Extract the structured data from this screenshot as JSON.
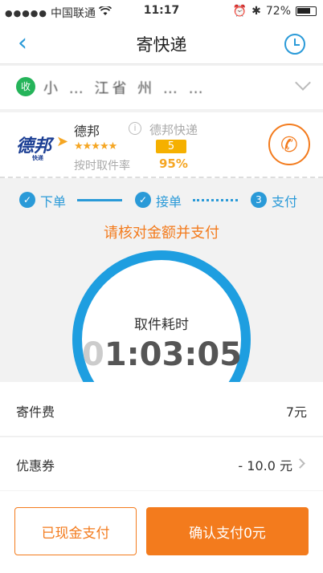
{
  "status_bar": {
    "carrier": "中国联通",
    "time": "11:17",
    "battery": "72%"
  },
  "nav": {
    "title": "寄快递"
  },
  "address": {
    "badge": "收",
    "text": "小 … 江省 州 …  …"
  },
  "courier": {
    "name": "德邦",
    "service": "德邦快递",
    "logo_text": "德邦",
    "logo_sub": "快递",
    "stars": "★★★★★",
    "rating": "5",
    "ontime_label": "按时取件率",
    "ontime_rate": "95%"
  },
  "steps": [
    {
      "label": "下单",
      "mark": "✓"
    },
    {
      "label": "接单",
      "mark": "✓"
    },
    {
      "label": "支付",
      "mark": "3"
    }
  ],
  "pay_prompt": "请核对金额并支付",
  "timer": {
    "label": "取件耗时",
    "lead_digit": "0",
    "value": "1:03:05"
  },
  "fee": {
    "label": "寄件费",
    "value": "7元"
  },
  "coupon": {
    "label": "优惠券",
    "value": "- 10.0 元"
  },
  "actions": {
    "cash_label": "已现金支付",
    "confirm_label": "确认支付0元"
  },
  "colors": {
    "accent_orange": "#f37b1d",
    "accent_blue": "#2a9ad8",
    "ring_blue": "#1e9ee0",
    "star_gold": "#f5a623"
  }
}
